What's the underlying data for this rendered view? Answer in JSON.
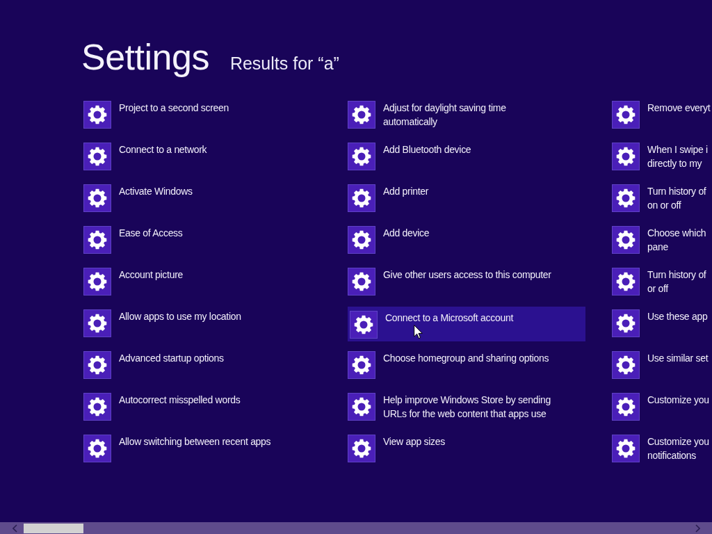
{
  "title": "Settings",
  "subtitle": "Results for “a”",
  "columns": [
    {
      "items": [
        {
          "lines": [
            "Project to a second screen"
          ],
          "selected": false
        },
        {
          "lines": [
            "Connect to a network"
          ],
          "selected": false
        },
        {
          "lines": [
            "Activate Windows"
          ],
          "selected": false
        },
        {
          "lines": [
            "Ease of Access"
          ],
          "selected": false
        },
        {
          "lines": [
            "Account picture"
          ],
          "selected": false
        },
        {
          "lines": [
            "Allow apps to use my location"
          ],
          "selected": false
        },
        {
          "lines": [
            "Advanced startup options"
          ],
          "selected": false
        },
        {
          "lines": [
            "Autocorrect misspelled words"
          ],
          "selected": false
        },
        {
          "lines": [
            "Allow switching between recent apps"
          ],
          "selected": false
        }
      ]
    },
    {
      "items": [
        {
          "lines": [
            "Adjust for daylight saving time",
            "automatically"
          ],
          "selected": false
        },
        {
          "lines": [
            "Add Bluetooth device"
          ],
          "selected": false
        },
        {
          "lines": [
            "Add printer"
          ],
          "selected": false
        },
        {
          "lines": [
            "Add device"
          ],
          "selected": false
        },
        {
          "lines": [
            "Give other users access to this computer"
          ],
          "selected": false
        },
        {
          "lines": [
            "Connect to a Microsoft account"
          ],
          "selected": true
        },
        {
          "lines": [
            "Choose homegroup and sharing options"
          ],
          "selected": false
        },
        {
          "lines": [
            "Help improve Windows Store by sending",
            "URLs for the web content that apps use"
          ],
          "selected": false
        },
        {
          "lines": [
            "View app sizes"
          ],
          "selected": false
        }
      ]
    },
    {
      "items": [
        {
          "lines": [
            "Remove everyt"
          ],
          "selected": false
        },
        {
          "lines": [
            "When I swipe i",
            "directly to my"
          ],
          "selected": false
        },
        {
          "lines": [
            "Turn history of",
            "on or off"
          ],
          "selected": false
        },
        {
          "lines": [
            "Choose which",
            "pane"
          ],
          "selected": false
        },
        {
          "lines": [
            "Turn history of",
            "or off"
          ],
          "selected": false
        },
        {
          "lines": [
            "Use these app"
          ],
          "selected": false
        },
        {
          "lines": [
            "Use similar set"
          ],
          "selected": false
        },
        {
          "lines": [
            "Customize you"
          ],
          "selected": false
        },
        {
          "lines": [
            "Customize you",
            "notifications"
          ],
          "selected": false
        }
      ]
    }
  ]
}
